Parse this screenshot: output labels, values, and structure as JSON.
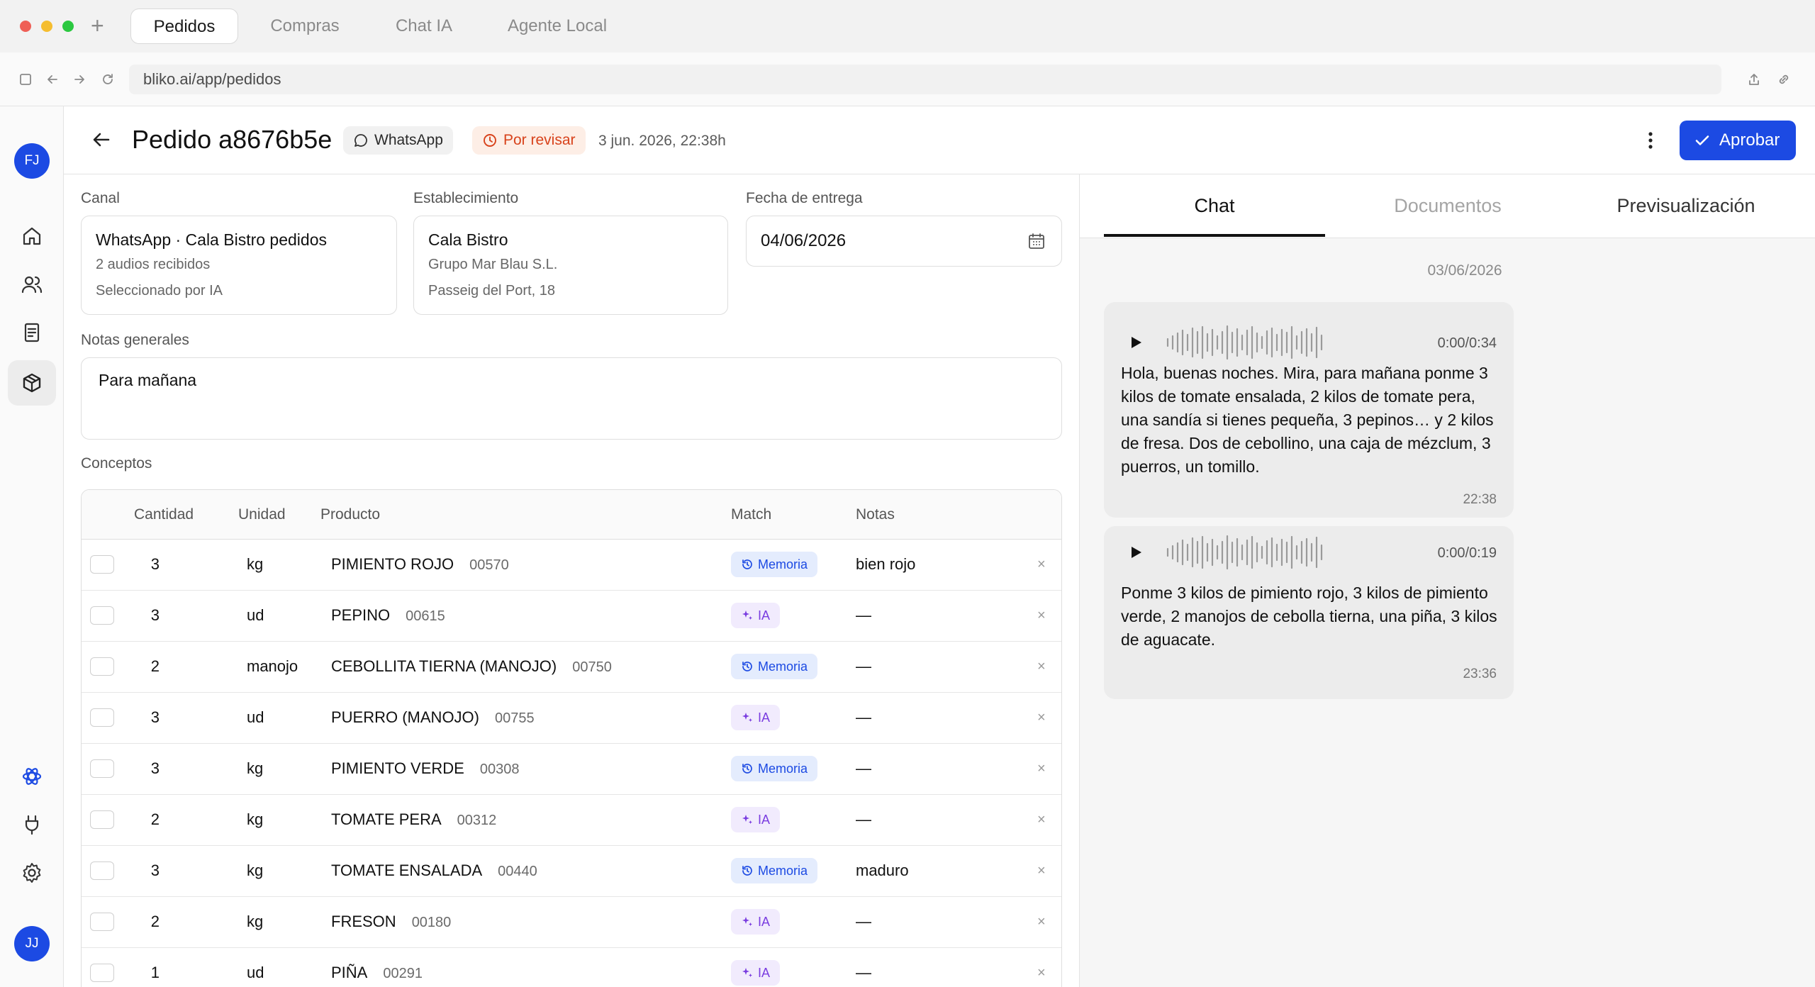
{
  "browser": {
    "tabs": [
      "Pedidos",
      "Compras",
      "Chat IA",
      "Agente Local"
    ],
    "url": "bliko.ai/app/pedidos"
  },
  "rail": {
    "top_avatar": "FJ",
    "bottom_avatar": "JJ",
    "icons": [
      "home-icon",
      "users-icon",
      "document-list-icon",
      "box-icon",
      "atom-icon",
      "plug-icon",
      "gear-icon"
    ]
  },
  "header": {
    "title": "Pedido a8676b5e",
    "channel_badge": "WhatsApp",
    "status_badge": "Por revisar",
    "datetime": "3 jun. 2026, 22:38h",
    "approve_label": "Aprobar"
  },
  "form": {
    "canal": {
      "label": "Canal",
      "line1": "WhatsApp · Cala Bistro pedidos",
      "line2": "2 audios recibidos",
      "line3": "Seleccionado por IA"
    },
    "establecimiento": {
      "label": "Establecimiento",
      "line1": "Cala Bistro",
      "line2": "Grupo Mar Blau S.L.",
      "line3": "Passeig del Port, 18"
    },
    "fecha": {
      "label": "Fecha de entrega",
      "value": "04/06/2026"
    },
    "notas": {
      "label": "Notas generales",
      "value": "Para mañana"
    },
    "conceptos_label": "Conceptos"
  },
  "table": {
    "headers": {
      "cantidad": "Cantidad",
      "unidad": "Unidad",
      "producto": "Producto",
      "match": "Match",
      "notas": "Notas"
    },
    "delete_glyph": "×",
    "rows": [
      {
        "qty": "3",
        "unit": "kg",
        "product": "PIMIENTO ROJO",
        "code": "00570",
        "match": "Memoria",
        "match_type": "mem",
        "note": "bien rojo"
      },
      {
        "qty": "3",
        "unit": "ud",
        "product": "PEPINO",
        "code": "00615",
        "match": "IA",
        "match_type": "ia",
        "note": "—"
      },
      {
        "qty": "2",
        "unit": "manojo",
        "product": "CEBOLLITA TIERNA (MANOJO)",
        "code": "00750",
        "match": "Memoria",
        "match_type": "mem",
        "note": "—"
      },
      {
        "qty": "3",
        "unit": "ud",
        "product": "PUERRO (MANOJO)",
        "code": "00755",
        "match": "IA",
        "match_type": "ia",
        "note": "—"
      },
      {
        "qty": "3",
        "unit": "kg",
        "product": "PIMIENTO VERDE",
        "code": "00308",
        "match": "Memoria",
        "match_type": "mem",
        "note": "—"
      },
      {
        "qty": "2",
        "unit": "kg",
        "product": "TOMATE PERA",
        "code": "00312",
        "match": "IA",
        "match_type": "ia",
        "note": "—"
      },
      {
        "qty": "3",
        "unit": "kg",
        "product": "TOMATE ENSALADA",
        "code": "00440",
        "match": "Memoria",
        "match_type": "mem",
        "note": "maduro"
      },
      {
        "qty": "2",
        "unit": "kg",
        "product": "FRESON",
        "code": "00180",
        "match": "IA",
        "match_type": "ia",
        "note": "—"
      },
      {
        "qty": "1",
        "unit": "ud",
        "product": "PIÑA",
        "code": "00291",
        "match": "IA",
        "match_type": "ia",
        "note": "—"
      }
    ]
  },
  "panel": {
    "tabs": [
      "Chat",
      "Documentos",
      "Previsualización"
    ],
    "chat_date": "03/06/2026",
    "messages": [
      {
        "duration": "0:00/0:34",
        "text": "Hola, buenas noches. Mira, para mañana ponme 3 kilos de tomate ensalada, 2 kilos de tomate pera, una sandía si tienes pequeña, 3 pepinos… y 2 kilos de fresa. Dos de cebollino, una caja de mézclum, 3 puerros, un tomillo.",
        "time": "22:38"
      },
      {
        "duration": "0:00/0:19",
        "text": "Ponme 3 kilos de pimiento rojo, 3 kilos de pimiento verde, 2 manojos de cebolla tierna, una piña, 3 kilos de aguacate.",
        "time": "23:36"
      }
    ]
  },
  "colors": {
    "accent": "#1c4ae3",
    "status": "#d8421b",
    "ia": "#7a3de0"
  }
}
